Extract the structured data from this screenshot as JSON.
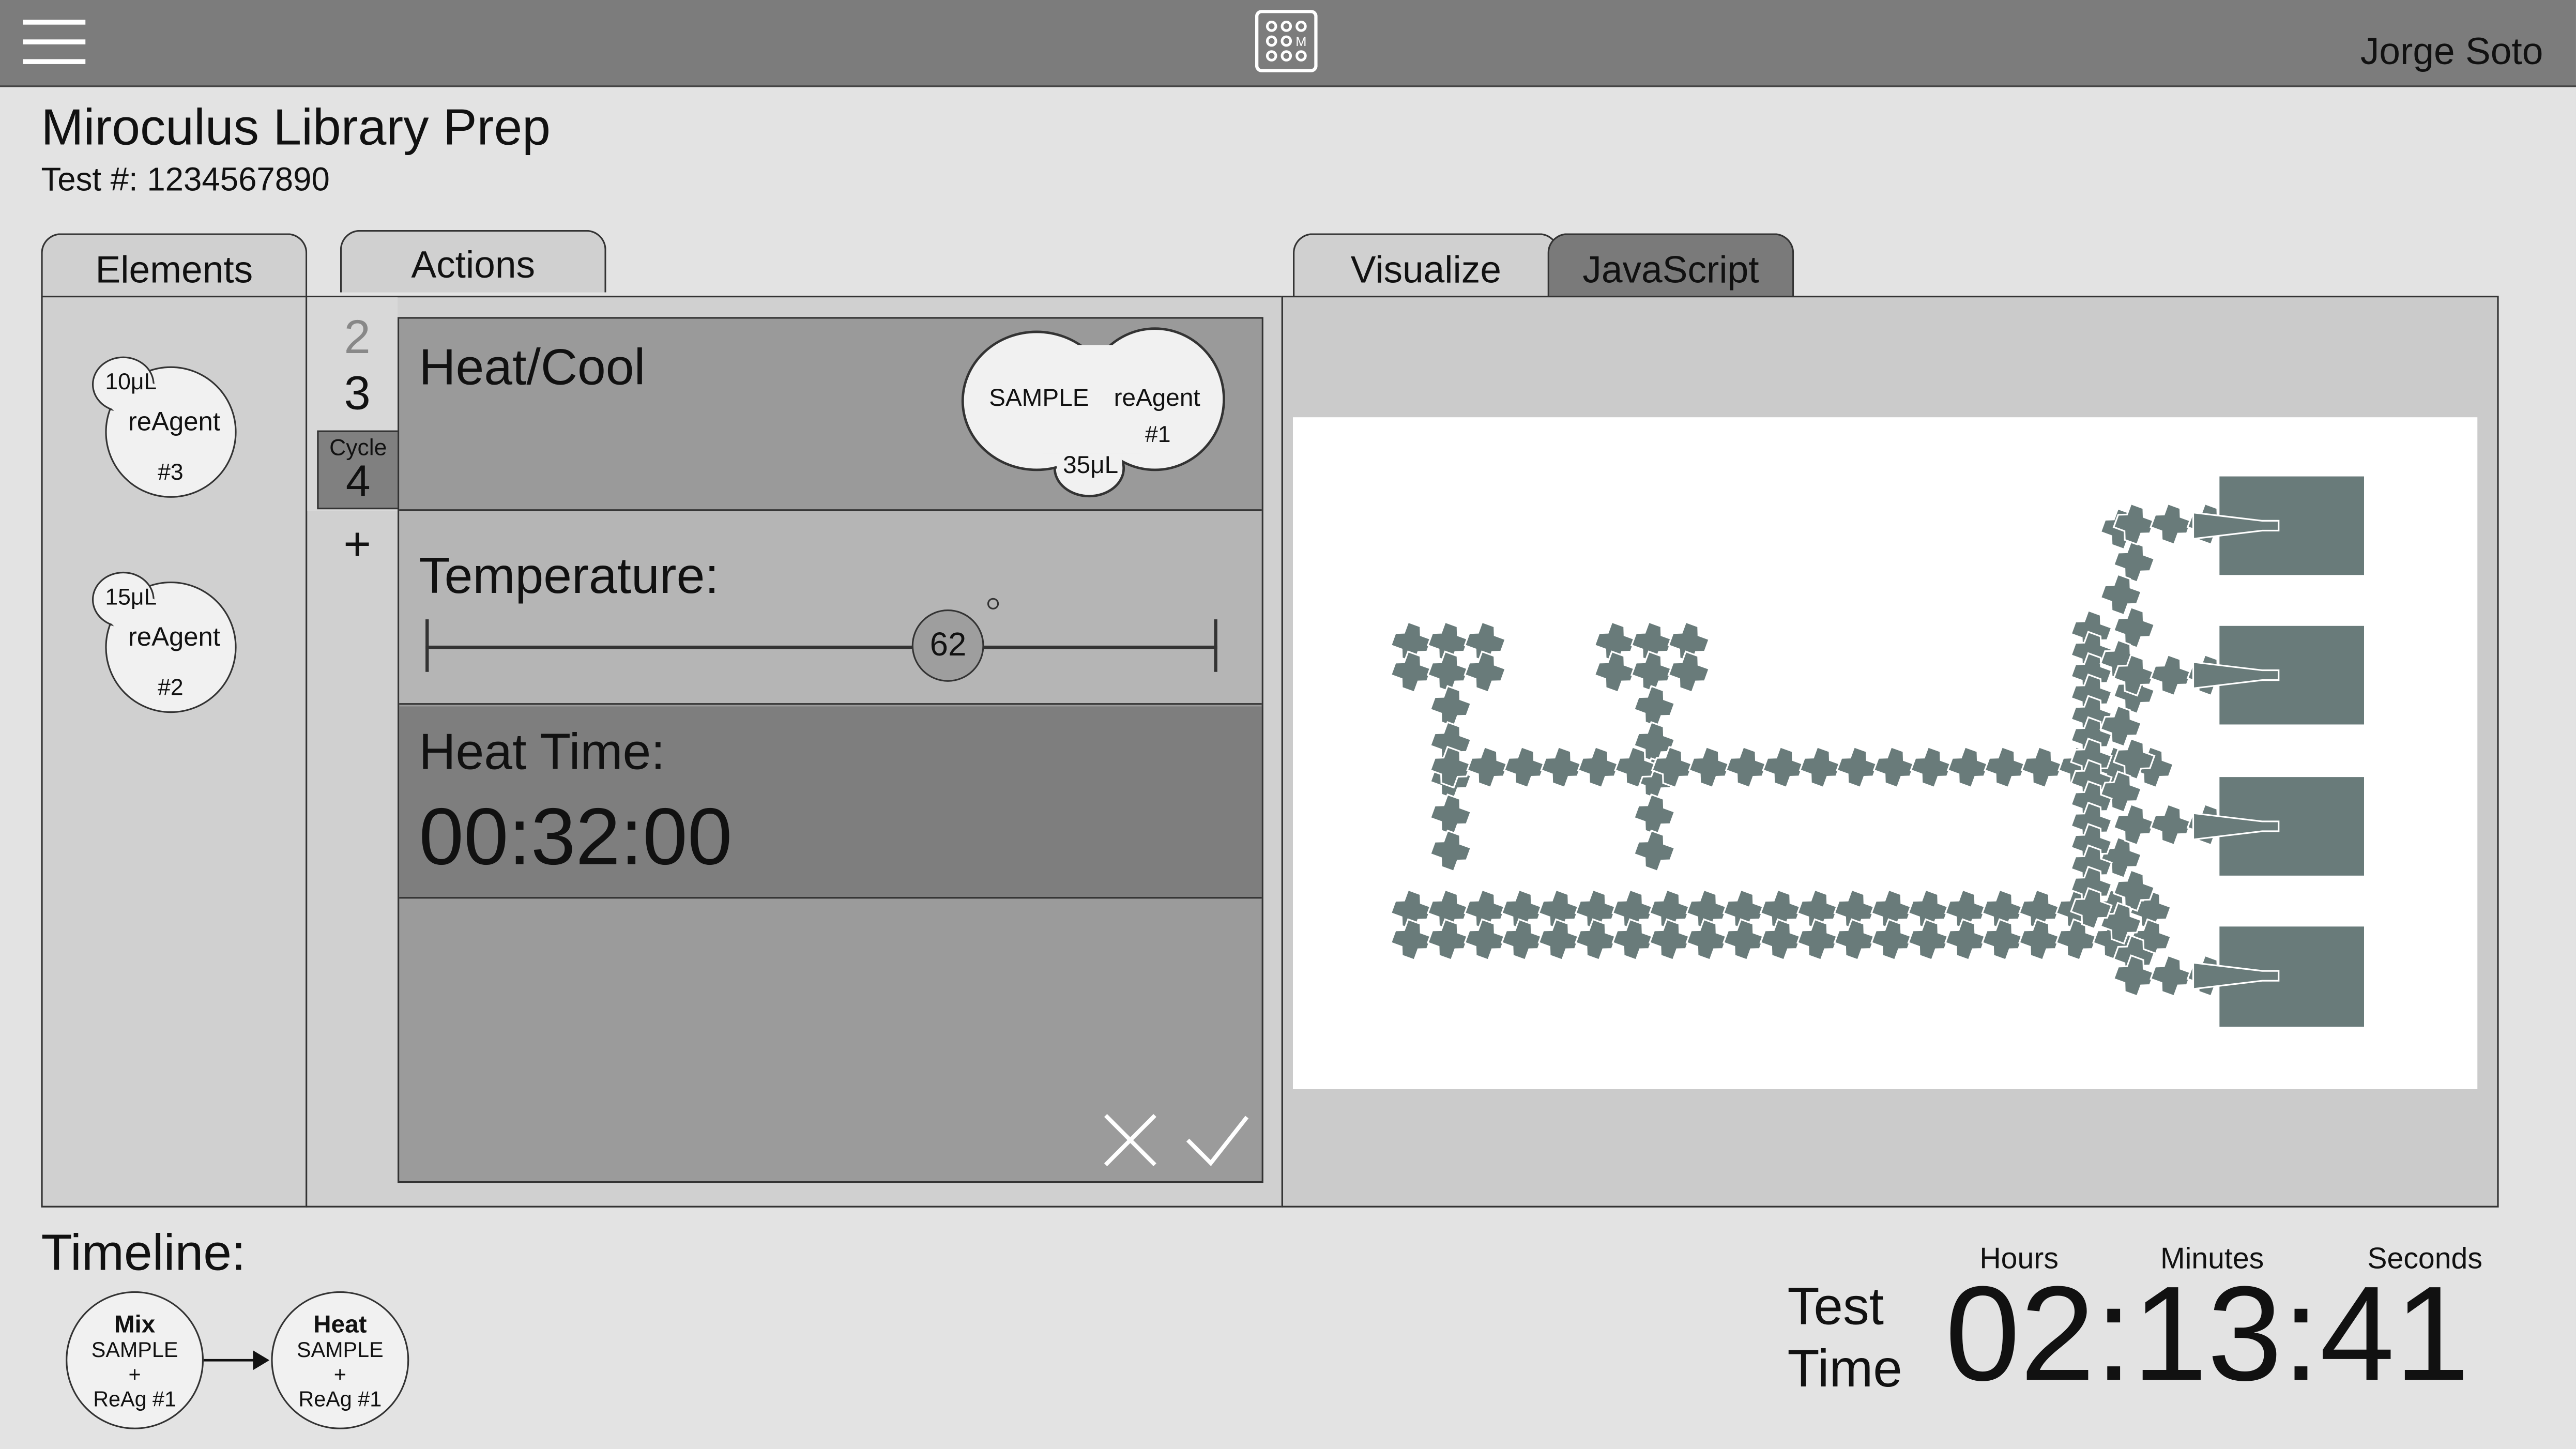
{
  "header": {
    "menu_icon": "hamburger-icon",
    "logo_icon": "grid-chip-icon",
    "user_name": "Jorge Soto"
  },
  "page": {
    "title": "Miroculus Library Prep",
    "test_number": "Test #: 1234567890"
  },
  "tabs": {
    "elements": "Elements",
    "actions": "Actions",
    "visualize": "Visualize",
    "javascript": "JavaScript"
  },
  "elements": [
    {
      "volume": "10μL",
      "name": "reAgent",
      "number": "#3"
    },
    {
      "volume": "15μL",
      "name": "reAgent",
      "number": "#2"
    }
  ],
  "steps": {
    "prev": "2",
    "current": "3",
    "cycle_label": "Cycle",
    "cycle_value": "4",
    "add": "+"
  },
  "action": {
    "title": "Heat/Cool",
    "sample_label": "SAMPLE",
    "reagent_label": "reAgent",
    "reagent_number": "#1",
    "volume": "35μL",
    "temperature_label": "Temperature:",
    "temperature_value": "62",
    "temperature_fraction": 0.66,
    "heat_time_label": "Heat Time:",
    "heat_time_value": "00:32:00",
    "cancel_icon": "close-icon",
    "confirm_icon": "check-icon"
  },
  "timeline": {
    "label": "Timeline:",
    "nodes": [
      {
        "title": "Mix",
        "line1": "SAMPLE",
        "line2": "+",
        "line3": "ReAg #1"
      },
      {
        "title": "Heat",
        "line1": "SAMPLE",
        "line2": "+",
        "line3": "ReAg #1"
      }
    ]
  },
  "test_time": {
    "label_line1": "Test",
    "label_line2": "Time",
    "hours_label": "Hours",
    "minutes_label": "Minutes",
    "seconds_label": "Seconds",
    "value": "02:13:41"
  },
  "colors": {
    "topbar": "#7c7c7c",
    "chip": "#697b7a",
    "active_tab": "#7a7a7a"
  }
}
